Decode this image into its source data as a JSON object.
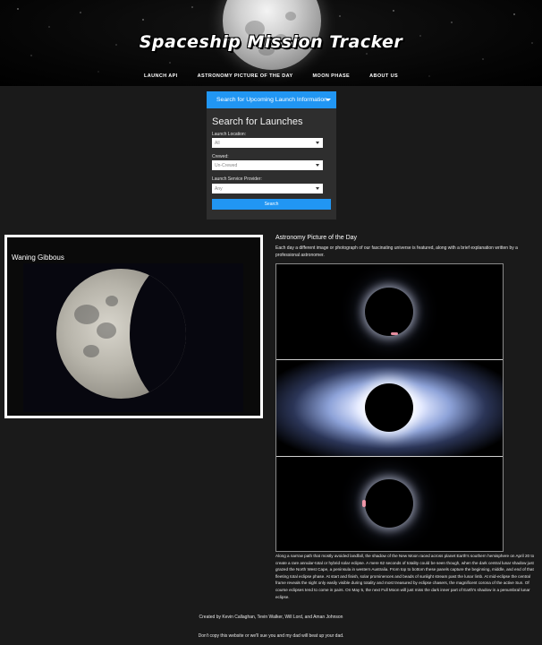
{
  "header": {
    "title": "Spaceship Mission Tracker",
    "nav": [
      "LAUNCH API",
      "ASTRONOMY PICTURE OF THE DAY",
      "MOON PHASE",
      "ABOUT US"
    ]
  },
  "search": {
    "dropdown_label": "Search for Upcoming Launch Information",
    "heading": "Search for Launches",
    "fields": [
      {
        "label": "Launch Location:",
        "value": "All"
      },
      {
        "label": "Crewed:",
        "value": "Un-Crewed"
      },
      {
        "label": "Launch Service Provider:",
        "value": "Any"
      }
    ],
    "submit_label": "Search"
  },
  "moon_phase": {
    "title": "Waning Gibbous"
  },
  "apod": {
    "heading": "Astronomy Picture of the Day",
    "intro": "Each day a different image or photograph of our fascinating universe is featured, along with a brief explanation written by a professional astronomer.",
    "explanation": "Along a narrow path that mostly avoided landfall, the shadow of the New Moon raced across planet Earth's southern hemisphere on April 20 to create a rare annular-total or hybrid solar eclipse. A mere 62 seconds of totality could be seen though, when the dark central lunar shadow just grazed the North West Cape, a peninsula in western Australia. From top to bottom these panels capture the beginning, middle, and end of that fleeting total eclipse phase. At start and finish, solar prominences and beads of sunlight stream past the lunar limb. At mid-eclipse the central frame reveals the sight only easily visible during totality and most treasured by eclipse chasers, the magnificent corona of the active Sun. Of course eclipses tend to come in pairs. On May 5, the next Full Moon will just miss the dark inner part of Earth's shadow in a penumbral lunar eclipse."
  },
  "footer": {
    "credits": "Created by Kevin Callaghan, Tevin Walker, Will Lord, and Aman Johnson",
    "warning": "Don't copy this website or we'll sue you and my dad will beat up your dad."
  },
  "colors": {
    "accent": "#2196f3",
    "background": "#1a1a1a",
    "panel": "#2e2e2e"
  }
}
